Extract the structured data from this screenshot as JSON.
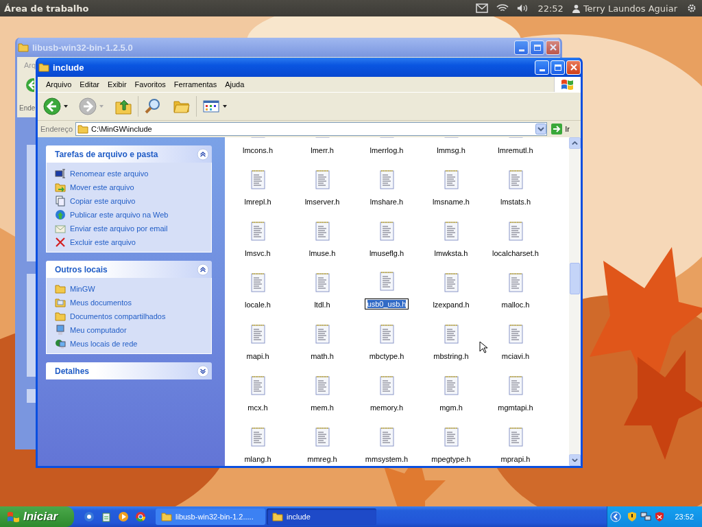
{
  "top_bar": {
    "title": "Área de trabalho",
    "clock": "22:52",
    "user": "Terry Laundos Aguiar"
  },
  "back_window": {
    "title": "libusb-win32-bin-1.2.5.0",
    "menu_fragment": "Arq",
    "address_fragment": "Ende"
  },
  "window": {
    "title": "include",
    "menu": [
      "Arquivo",
      "Editar",
      "Exibir",
      "Favoritos",
      "Ferramentas",
      "Ajuda"
    ],
    "address": {
      "label": "Endereço",
      "value": "C:\\MinGW\\include",
      "go": "Ir"
    },
    "panels": [
      {
        "title": "Tarefas de arquivo e pasta",
        "expanded": true,
        "items": [
          {
            "label": "Renomear este arquivo",
            "kind": "rename"
          },
          {
            "label": "Mover este arquivo",
            "kind": "move"
          },
          {
            "label": "Copiar este arquivo",
            "kind": "copy"
          },
          {
            "label": "Publicar este arquivo na Web",
            "kind": "web"
          },
          {
            "label": "Enviar este arquivo por email",
            "kind": "email"
          },
          {
            "label": "Excluir este arquivo",
            "kind": "delete"
          }
        ]
      },
      {
        "title": "Outros locais",
        "expanded": true,
        "items": [
          {
            "label": "MinGW",
            "kind": "folder"
          },
          {
            "label": "Meus documentos",
            "kind": "documents"
          },
          {
            "label": "Documentos compartilhados",
            "kind": "folder"
          },
          {
            "label": "Meu computador",
            "kind": "computer"
          },
          {
            "label": "Meus locais de rede",
            "kind": "network"
          }
        ]
      },
      {
        "title": "Detalhes",
        "expanded": false
      }
    ],
    "files": [
      {
        "name": "lmcons.h",
        "selected": false
      },
      {
        "name": "lmerr.h",
        "selected": false
      },
      {
        "name": "lmerrlog.h",
        "selected": false
      },
      {
        "name": "lmmsg.h",
        "selected": false
      },
      {
        "name": "lmremutl.h",
        "selected": false
      },
      {
        "name": "lmrepl.h",
        "selected": false
      },
      {
        "name": "lmserver.h",
        "selected": false
      },
      {
        "name": "lmshare.h",
        "selected": false
      },
      {
        "name": "lmsname.h",
        "selected": false
      },
      {
        "name": "lmstats.h",
        "selected": false
      },
      {
        "name": "lmsvc.h",
        "selected": false
      },
      {
        "name": "lmuse.h",
        "selected": false
      },
      {
        "name": "lmuseflg.h",
        "selected": false
      },
      {
        "name": "lmwksta.h",
        "selected": false
      },
      {
        "name": "localcharset.h",
        "selected": false
      },
      {
        "name": "locale.h",
        "selected": false
      },
      {
        "name": "ltdl.h",
        "selected": false
      },
      {
        "name": "usb0_usb.h",
        "selected": true
      },
      {
        "name": "lzexpand.h",
        "selected": false
      },
      {
        "name": "malloc.h",
        "selected": false
      },
      {
        "name": "mapi.h",
        "selected": false
      },
      {
        "name": "math.h",
        "selected": false
      },
      {
        "name": "mbctype.h",
        "selected": false
      },
      {
        "name": "mbstring.h",
        "selected": false
      },
      {
        "name": "mciavi.h",
        "selected": false
      },
      {
        "name": "mcx.h",
        "selected": false
      },
      {
        "name": "mem.h",
        "selected": false
      },
      {
        "name": "memory.h",
        "selected": false
      },
      {
        "name": "mgm.h",
        "selected": false
      },
      {
        "name": "mgmtapi.h",
        "selected": false
      },
      {
        "name": "mlang.h",
        "selected": false
      },
      {
        "name": "mmreg.h",
        "selected": false
      },
      {
        "name": "mmsystem.h",
        "selected": false
      },
      {
        "name": "mpegtype.h",
        "selected": false
      },
      {
        "name": "mprapi.h",
        "selected": false
      }
    ]
  },
  "taskbar": {
    "start": "Iniciar",
    "tasks": [
      {
        "label": "libusb-win32-bin-1.2.....",
        "selected": false
      },
      {
        "label": "include",
        "selected": true
      }
    ],
    "clock": "23:52"
  }
}
